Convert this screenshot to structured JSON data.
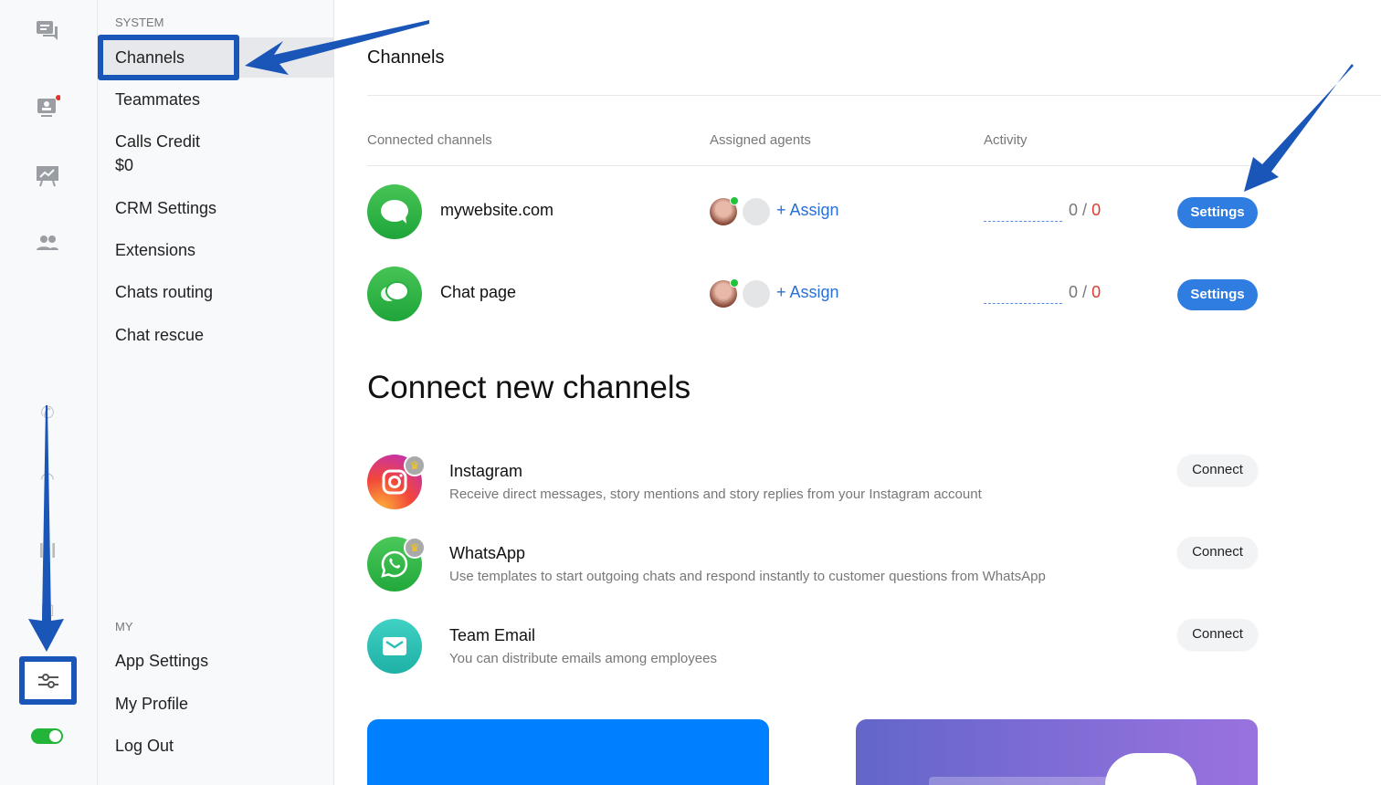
{
  "rail": {
    "icons": [
      "chats-icon",
      "visitors-icon",
      "reports-icon",
      "team-icon",
      "phone-icon",
      "headset-icon",
      "pause-icon",
      "bag-icon",
      "settings-sliders-icon",
      "online-toggle"
    ],
    "toggle_on": true
  },
  "sidebar": {
    "system_label": "SYSTEM",
    "items": [
      {
        "label": "Channels"
      },
      {
        "label": "Teammates"
      },
      {
        "label": "Calls Credit",
        "sub": "$0"
      },
      {
        "label": "CRM Settings"
      },
      {
        "label": "Extensions"
      },
      {
        "label": "Chats routing"
      },
      {
        "label": "Chat rescue"
      }
    ],
    "my_label": "MY",
    "my_items": [
      {
        "label": "App Settings"
      },
      {
        "label": "My Profile"
      },
      {
        "label": "Log Out"
      }
    ]
  },
  "main": {
    "title": "Channels",
    "columns": [
      "Connected channels",
      "Assigned agents",
      "Activity"
    ],
    "channels": [
      {
        "name": "mywebsite.com",
        "assign": "+ Assign",
        "activity_a": "0",
        "sep": "/",
        "activity_b": "0",
        "button": "Settings"
      },
      {
        "name": "Chat page",
        "assign": "+ Assign",
        "activity_a": "0",
        "sep": "/",
        "activity_b": "0",
        "button": "Settings"
      }
    ],
    "connect_title": "Connect new channels",
    "new_channels": [
      {
        "name": "Instagram",
        "desc": "Receive direct messages, story mentions and story replies from your Instagram account",
        "button": "Connect"
      },
      {
        "name": "WhatsApp",
        "desc": "Use templates to start outgoing chats and respond instantly to customer questions from WhatsApp",
        "button": "Connect"
      },
      {
        "name": "Team Email",
        "desc": "You can distribute emails among employees",
        "button": "Connect"
      }
    ]
  },
  "colors": {
    "accent": "#2f7de1",
    "green": "#1ea53a",
    "annotation": "#1a56b8",
    "red": "#e03a2e"
  }
}
